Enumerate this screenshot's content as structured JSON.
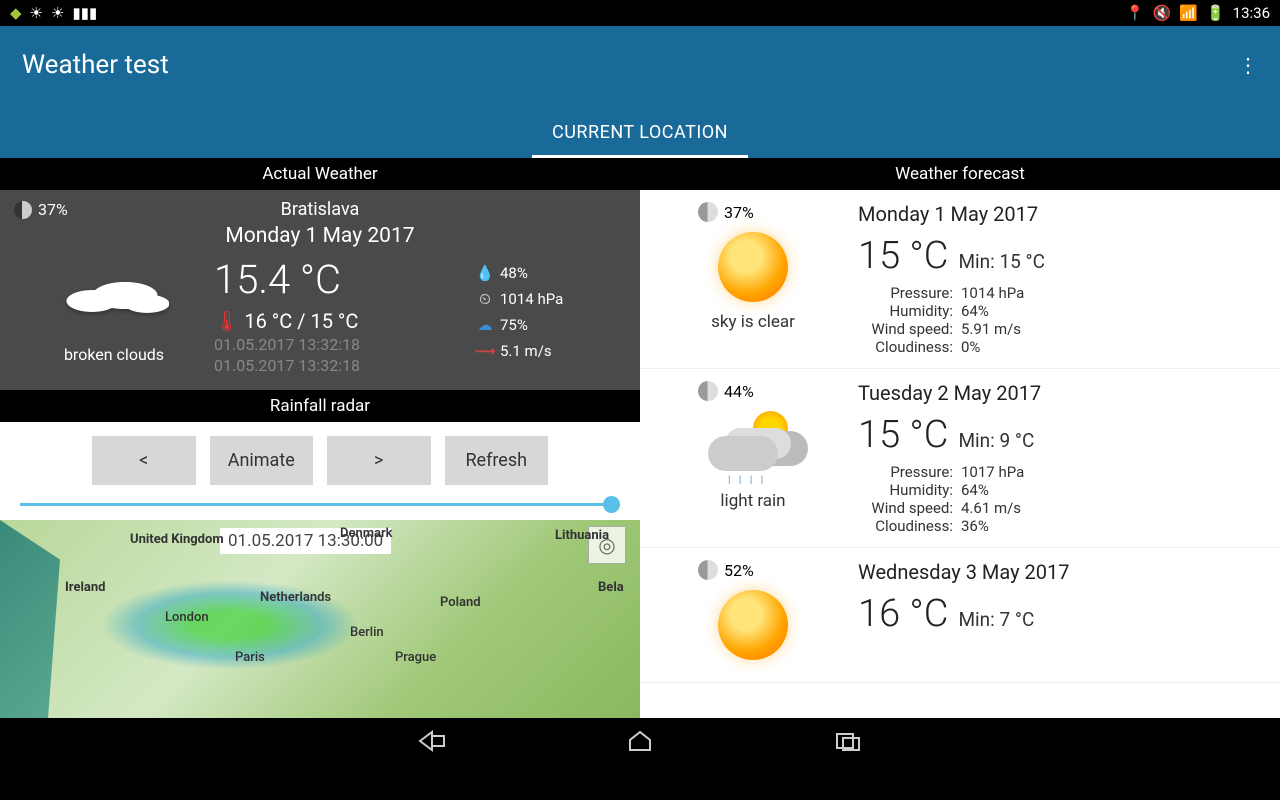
{
  "status": {
    "time": "13:36"
  },
  "header": {
    "title": "Weather test",
    "tab": "CURRENT LOCATION"
  },
  "sections": {
    "actual": "Actual Weather",
    "forecast": "Weather forecast",
    "radar": "Rainfall radar"
  },
  "actual": {
    "moon_pct": "37%",
    "city": "Bratislava",
    "date": "Monday 1 May 2017",
    "temp": "15.4 °C",
    "minmax": "16 °C / 15 °C",
    "desc": "broken clouds",
    "ts1": "01.05.2017 13:32:18",
    "ts2": "01.05.2017 13:32:18",
    "humidity": "48%",
    "pressure": "1014 hPa",
    "clouds": "75%",
    "wind": "5.1 m/s"
  },
  "radar": {
    "prev": "<",
    "animate": "Animate",
    "next": ">",
    "refresh": "Refresh",
    "timestamp": "01.05.2017 13:30:00",
    "labels": {
      "uk": "United Kingdom",
      "ireland": "Ireland",
      "london": "London",
      "netherlands": "Netherlands",
      "paris": "Paris",
      "berlin": "Berlin",
      "prague": "Prague",
      "denmark": "Denmark",
      "poland": "Poland",
      "lithuania": "Lithuania",
      "bela": "Bela"
    }
  },
  "forecast": [
    {
      "moon_pct": "37%",
      "desc": "sky is clear",
      "icon": "sun",
      "date": "Monday 1 May 2017",
      "temp": "15 °C",
      "min": "Min: 15 °C",
      "pressure": "1014 hPa",
      "humidity": "64%",
      "wind": "5.91 m/s",
      "clouds": "0%"
    },
    {
      "moon_pct": "44%",
      "desc": "light rain",
      "icon": "rain",
      "date": "Tuesday 2 May 2017",
      "temp": "15 °C",
      "min": "Min: 9 °C",
      "pressure": "1017 hPa",
      "humidity": "64%",
      "wind": "4.61 m/s",
      "clouds": "36%"
    },
    {
      "moon_pct": "52%",
      "desc": "",
      "icon": "sun",
      "date": "Wednesday 3 May 2017",
      "temp": "16 °C",
      "min": "Min: 7 °C",
      "pressure": "",
      "humidity": "",
      "wind": "",
      "clouds": ""
    }
  ],
  "labels": {
    "pressure": "Pressure:",
    "humidity": "Humidity:",
    "wind": "Wind speed:",
    "clouds": "Cloudiness:"
  }
}
